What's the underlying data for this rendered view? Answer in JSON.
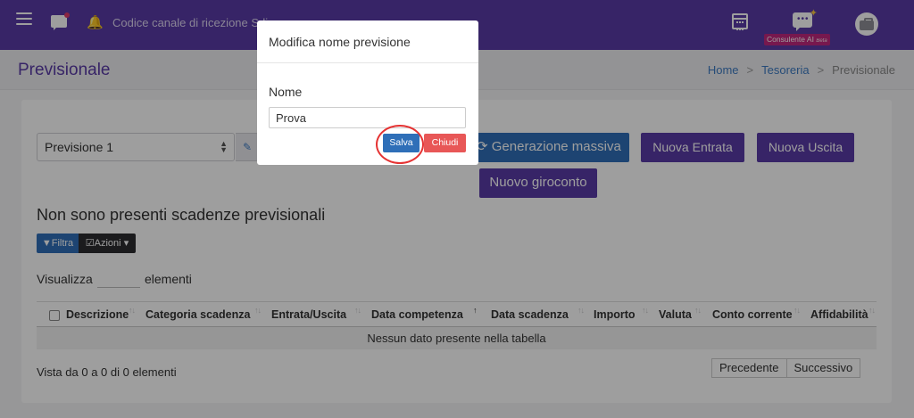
{
  "topbar": {
    "title": "Codice canale di ricezione Sdi",
    "ai_badge_label": "Consulente AI",
    "ai_badge_beta": "Beta"
  },
  "page": {
    "title": "Previsionale",
    "breadcrumb": [
      "Home",
      "Tesoreria",
      "Previsionale"
    ]
  },
  "toolbar": {
    "selected_forecast": "Previsione 1",
    "generate_label": "Generazione massiva",
    "new_income_label": "Nuova Entrata",
    "new_expense_label": "Nuova Uscita",
    "new_transfer_label": "Nuovo giroconto"
  },
  "list": {
    "empty_title": "Non sono presenti scadenze previsionali",
    "filter_label": "Filtra",
    "actions_label": "Azioni",
    "show_label": "Visualizza",
    "elements_label": "elementi",
    "columns": [
      "Descrizione",
      "Categoria scadenza",
      "Entrata/Uscita",
      "Data competenza",
      "Data scadenza",
      "Importo",
      "Valuta",
      "Conto corrente",
      "Affidabilità"
    ],
    "no_data": "Nessun dato presente nella tabella",
    "info": "Vista da 0 a 0 di 0 elementi",
    "prev_label": "Precedente",
    "next_label": "Successivo"
  },
  "modal": {
    "title": "Modifica nome previsione",
    "field_label": "Nome",
    "field_value": "Prova",
    "save_label": "Salva",
    "close_label": "Chiudi"
  },
  "colors": {
    "brand_purple": "#5a3aa6",
    "primary_blue": "#2f6fb8",
    "danger_red": "#e85757",
    "highlight_red": "#e53333"
  }
}
